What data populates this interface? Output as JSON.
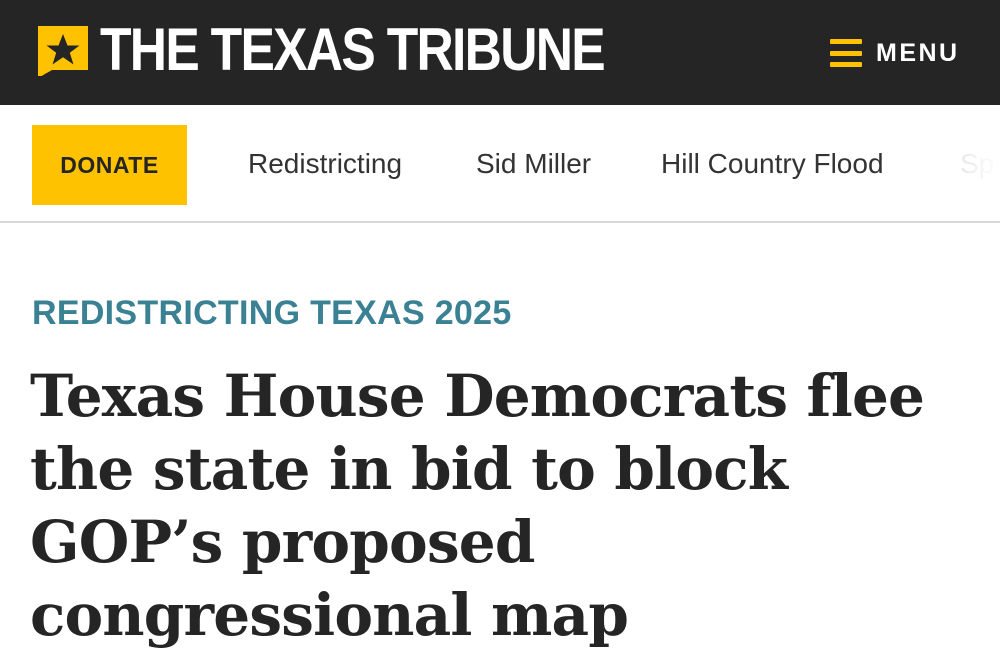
{
  "masthead": {
    "logo_text": "THE TEXAS TRIBUNE",
    "logo_icon": "star-badge-icon",
    "menu_icon": "hamburger-icon",
    "menu_label": "MENU",
    "colors": {
      "background": "#252525",
      "accent": "#ffc200",
      "text": "#ffffff"
    }
  },
  "nav": {
    "donate_label": "DONATE",
    "items": [
      {
        "label": "Redistricting"
      },
      {
        "label": "Sid Miller"
      },
      {
        "label": "Hill Country Flood"
      },
      {
        "label": "Sp"
      }
    ]
  },
  "article": {
    "kicker": "REDISTRICTING TEXAS 2025",
    "kicker_color": "#3a8194",
    "headline": "Texas House Democrats flee the state in bid to block GOP’s proposed congressional map"
  }
}
